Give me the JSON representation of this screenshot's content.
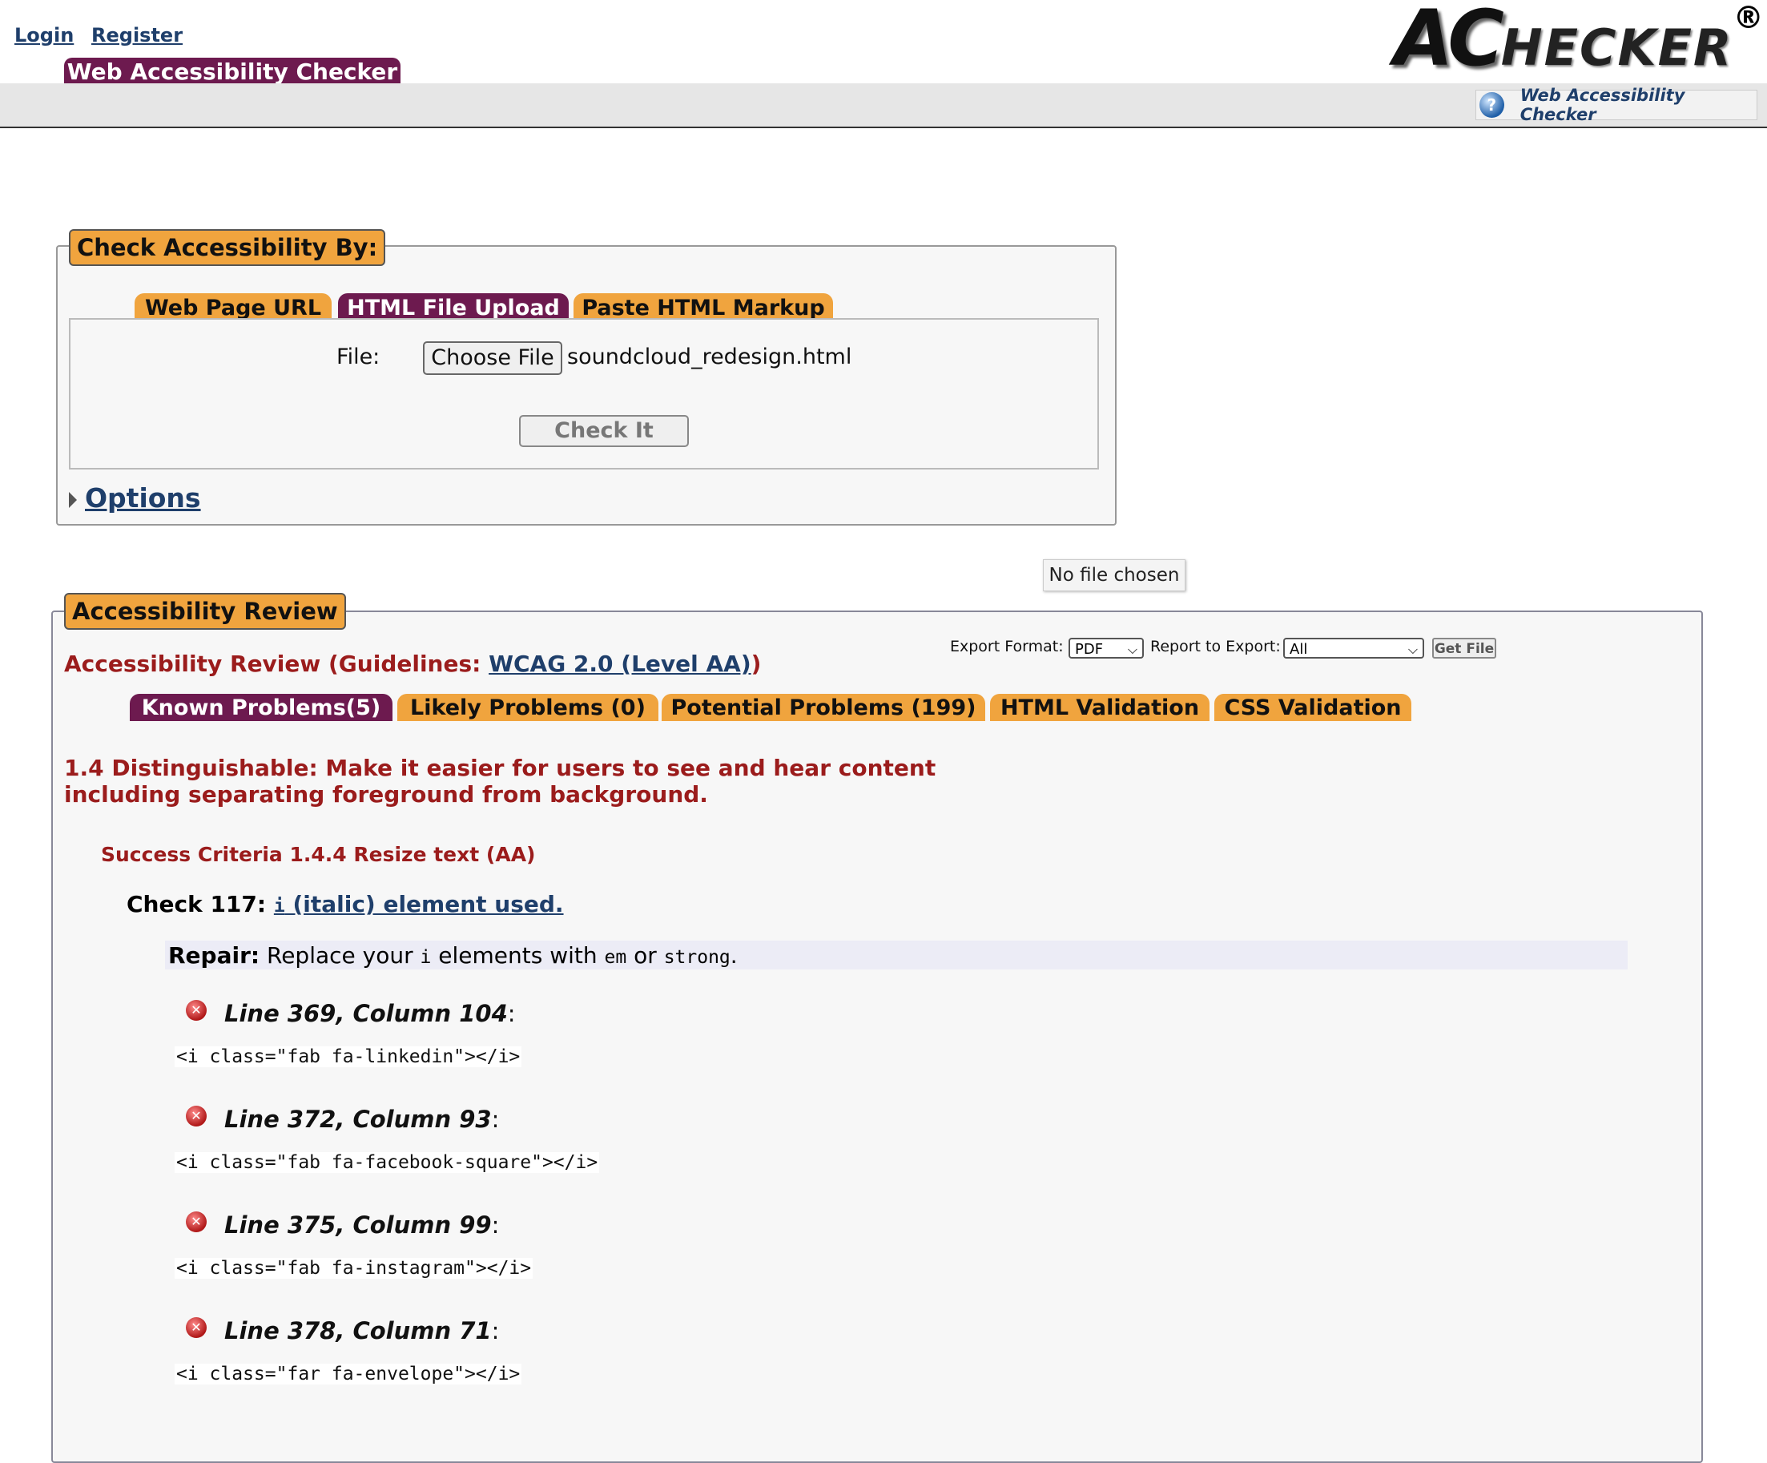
{
  "header": {
    "login": "Login",
    "register": "Register",
    "logo": {
      "big": "AC",
      "rest": "HECKER",
      "reg": "®"
    },
    "site_tab": "Web Accessibility Checker",
    "help_link": "Web Accessibility Checker"
  },
  "check_box": {
    "legend": "Check Accessibility By:",
    "tabs": [
      "Web Page URL",
      "HTML File Upload",
      "Paste HTML Markup"
    ],
    "active_tab": "HTML File Upload",
    "file_label": "File:",
    "choose_button": "Choose File",
    "file_name": "soundcloud_redesign.html",
    "check_button": "Check It",
    "options_link": "Options",
    "tooltip": "No file chosen"
  },
  "review": {
    "legend": "Accessibility Review",
    "title_prefix": "Accessibility Review (Guidelines: ",
    "guideline_link": "WCAG 2.0 (Level AA)",
    "title_suffix": ")",
    "export_format_label": "Export Format:",
    "export_format_value": "PDF",
    "report_label": "Report to Export:",
    "report_value": "All",
    "get_file": "Get File",
    "tabs": [
      "Known Problems(5)",
      "Likely Problems (0)",
      "Potential Problems (199)",
      "HTML Validation",
      "CSS Validation"
    ],
    "guideline_heading_line1": "1.4 Distinguishable: Make it easier for users to see and hear content",
    "guideline_heading_line2": "including separating foreground from background.",
    "success_criteria": "Success Criteria 1.4.4 Resize text (AA)",
    "check_label": "Check 117:",
    "check_link_code": "i",
    "check_link_text": " (italic) element used.",
    "repair_label": "Repair:",
    "repair_text_1": " Replace your ",
    "repair_code_1": "i",
    "repair_text_2": " elements with ",
    "repair_code_2": "em",
    "repair_text_3": " or ",
    "repair_code_3": "strong",
    "repair_text_4": ".",
    "problems": [
      {
        "location": "Line 369, Column 104",
        "code": "<i class=\"fab fa-linkedin\"></i>"
      },
      {
        "location": "Line 372, Column 93",
        "code": "<i class=\"fab fa-facebook-square\"></i>"
      },
      {
        "location": "Line 375, Column 99",
        "code": "<i class=\"fab fa-instagram\"></i>"
      },
      {
        "location": "Line 378, Column 71",
        "code": "<i class=\"far fa-envelope\"></i>"
      }
    ],
    "colon": ":"
  },
  "colors": {
    "purple": "#6d1a4f",
    "orange": "#f0a43e",
    "dark_red": "#9b1c1c",
    "link": "#1f3f6b"
  }
}
